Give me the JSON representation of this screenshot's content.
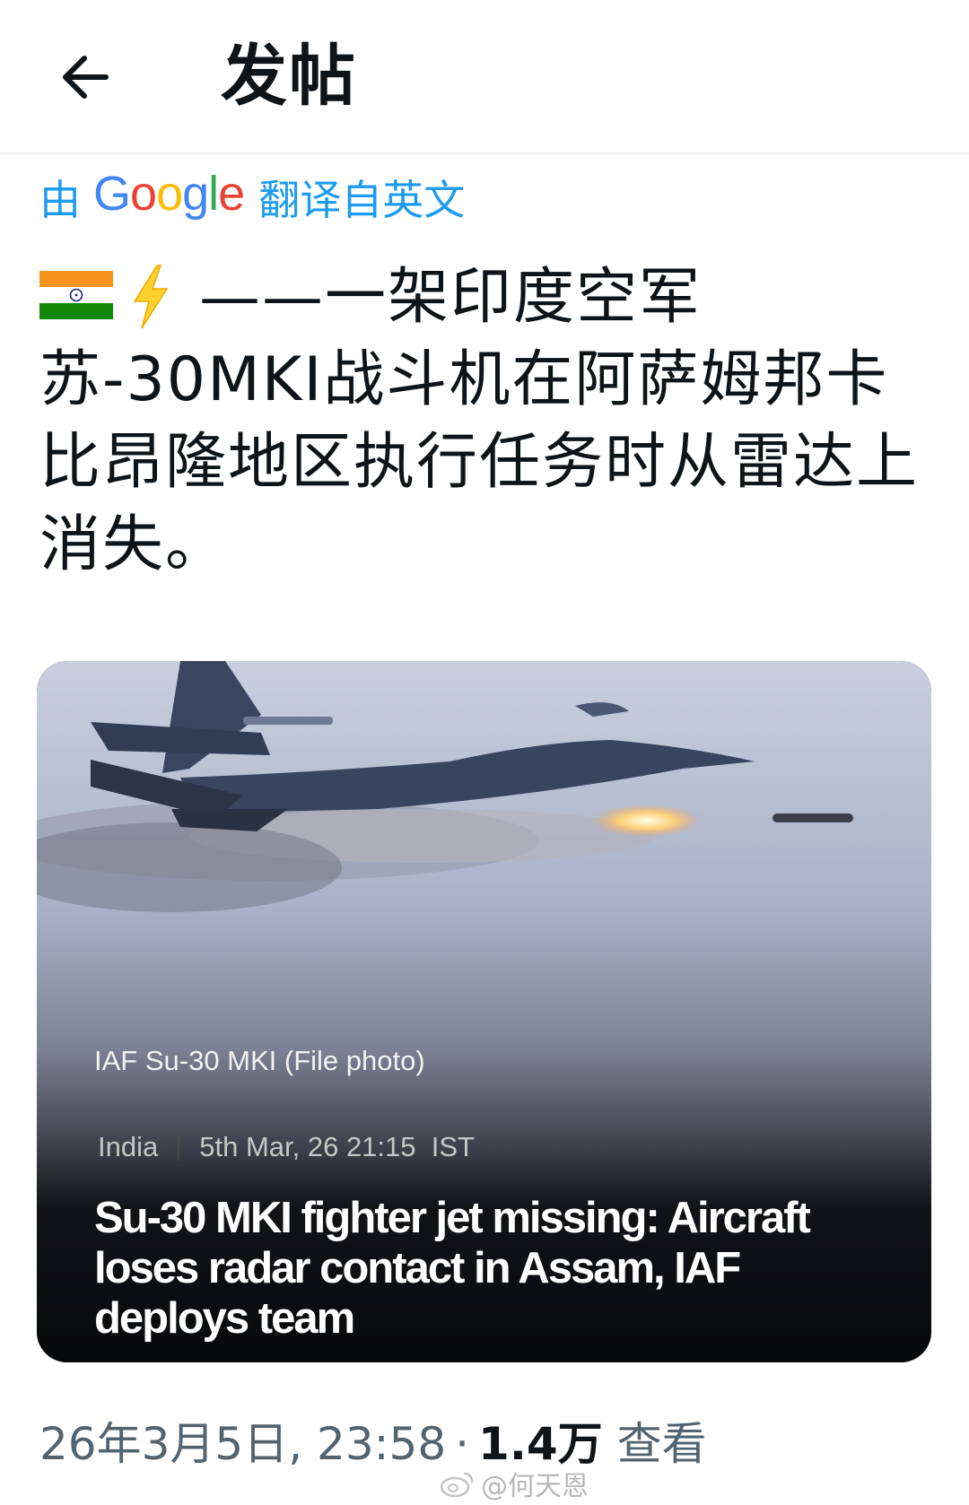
{
  "header": {
    "title": "发帖"
  },
  "translation": {
    "prefix": "由",
    "logo_text": "Google",
    "suffix": "翻译自英文"
  },
  "tweet": {
    "emoji_flag": "india-flag-icon",
    "emoji_bolt": "lightning-icon",
    "text": "——一架印度空军苏-30MKI战斗机在阿萨姆邦卡比昂隆地区执行任务时从雷达上消失。"
  },
  "card": {
    "photo_caption": "IAF Su-30 MKI (File photo)",
    "category": "India",
    "timestamp": "5th Mar, 26 21:15  IST",
    "headline": "Su-30 MKI fighter jet missing: Aircraft loses radar contact in Assam, IAF deploys team"
  },
  "footer": {
    "datetime": "26年3月5日, 23:58",
    "separator": "·",
    "views_count": "1.4万",
    "views_label": "查看"
  },
  "watermark": {
    "text": "@何天恩"
  },
  "colors": {
    "accent": "#1d9bf0",
    "text": "#0f1419",
    "muted": "#536471"
  }
}
